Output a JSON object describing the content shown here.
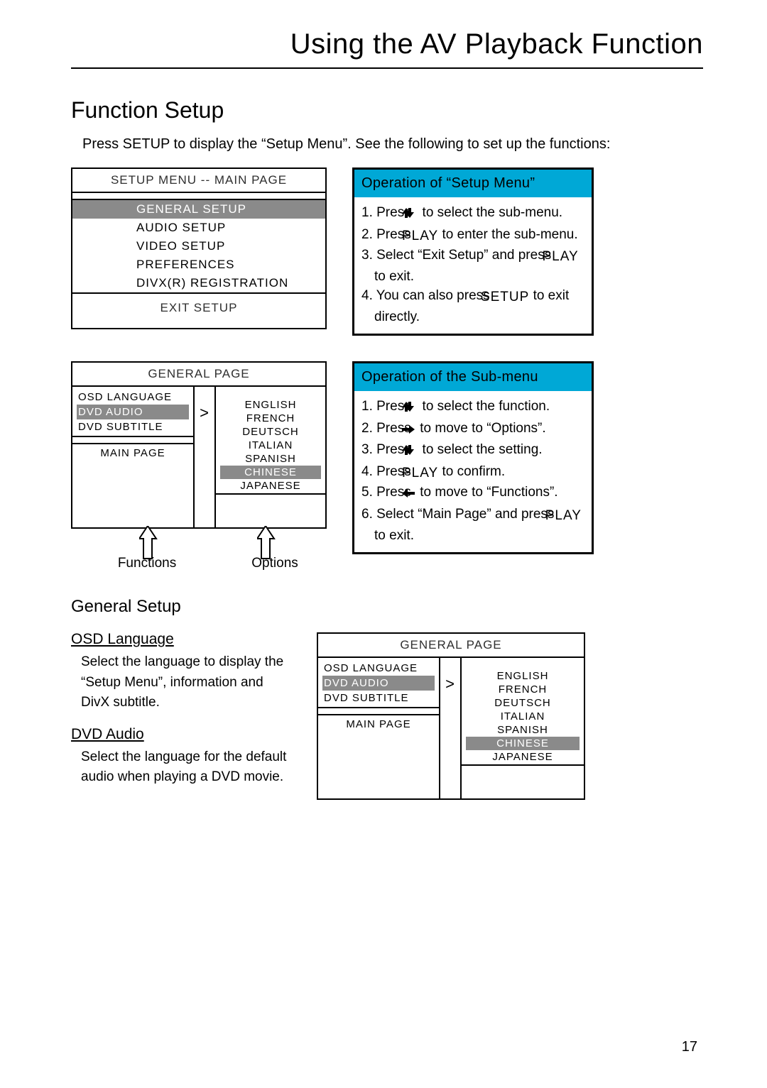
{
  "page": {
    "title": "Using the AV Playback Function",
    "number": "17"
  },
  "section1": {
    "heading": "Function Setup",
    "lead": "Press SETUP to display the “Setup Menu”. See the following to set up the functions:"
  },
  "setup_menu_screen": {
    "title": "SETUP MENU -- MAIN PAGE",
    "items": {
      "general": "GENERAL SETUP",
      "audio": "AUDIO SETUP",
      "video": "VIDEO SETUP",
      "pref": "PREFERENCES",
      "divx": "DIVX(R) REGISTRATION"
    },
    "exit": "EXIT SETUP"
  },
  "info_setup": {
    "heading": "Operation of “Setup Menu”",
    "step1a": "1. Press",
    "step1b": "to select the sub-menu.",
    "step2a": "2. Press",
    "step2_play": "PLAY",
    "step2b": "to enter the sub-menu.",
    "step3a": "3. Select “Exit Setup” and press",
    "step3_play": "PLAY",
    "step3b": "to exit.",
    "step4a": "4. You can also press",
    "step4_setup": "SETUP",
    "step4b": "to exit directly."
  },
  "general_page_screen": {
    "title": "GENERAL PAGE",
    "functions": {
      "osd": "OSD LANGUAGE",
      "dvd_audio": "DVD AUDIO",
      "dvd_sub": "DVD SUBTITLE",
      "main": "MAIN PAGE"
    },
    "options": {
      "english": "ENGLISH",
      "french": "FRENCH",
      "deutsch": "DEUTSCH",
      "italian": "ITALIAN",
      "spanish": "SPANISH",
      "chinese": "CHINESE",
      "japanese": "JAPANESE"
    },
    "labels": {
      "functions": "Functions",
      "options": "Options"
    }
  },
  "info_submenu": {
    "heading": "Operation of the Sub-menu",
    "s1a": "1. Press",
    "s1b": "to select the function.",
    "s2a": "2. Press",
    "s2b": "to move to “Options”.",
    "s3a": "3. Press",
    "s3b": "to select the setting.",
    "s4a": "4. Press",
    "s4_play": "PLAY",
    "s4b": "to confirm.",
    "s5a": "5. Press",
    "s5b": "to move to “Functions”.",
    "s6a": "6. Select “Main Page” and press",
    "s6_play": "PLAY",
    "s6b": "to exit."
  },
  "general_setup": {
    "heading": "General Setup",
    "osd": {
      "title": "OSD Language",
      "text": "Select the language to display the “Setup Menu”, information and DivX subtitle."
    },
    "dvd": {
      "title": "DVD Audio",
      "text": "Select the language for the default audio when playing a DVD movie."
    }
  }
}
